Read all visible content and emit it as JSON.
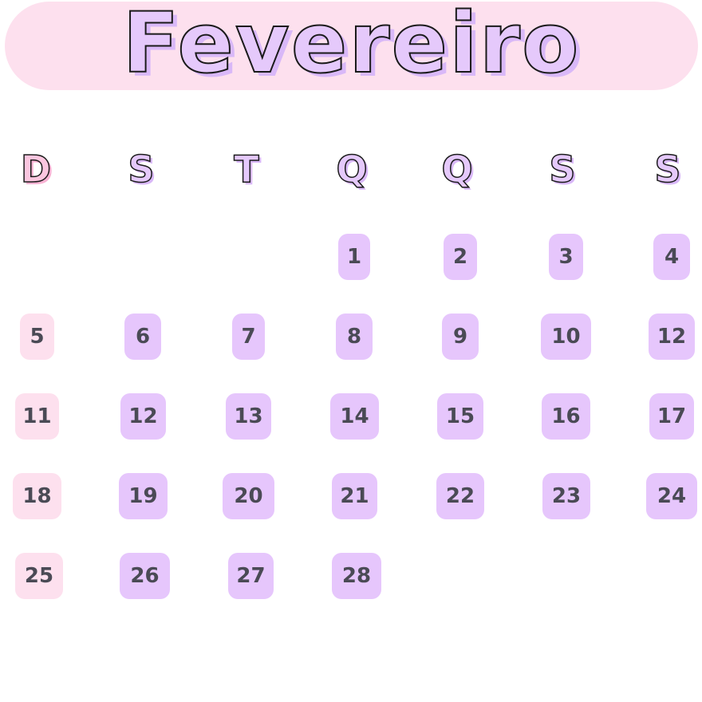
{
  "calendar": {
    "month": "Fevereiro",
    "weekdays": [
      "D",
      "S",
      "T",
      "Q",
      "Q",
      "S",
      "S"
    ],
    "weeks": [
      [
        "",
        "",
        "",
        "1",
        "2",
        "3",
        "4"
      ],
      [
        "5",
        "6",
        "7",
        "8",
        "9",
        "10",
        "12"
      ],
      [
        "11",
        "12",
        "13",
        "14",
        "15",
        "16",
        "17"
      ],
      [
        "18",
        "19",
        "20",
        "21",
        "22",
        "23",
        "24"
      ],
      [
        "25",
        "26",
        "27",
        "28",
        "",
        "",
        ""
      ]
    ]
  },
  "colors": {
    "banner": "#fde0ee",
    "day_cell": "#e6c6fc",
    "sunday_cell": "#fde0ee",
    "day_text": "#4a4a55"
  }
}
